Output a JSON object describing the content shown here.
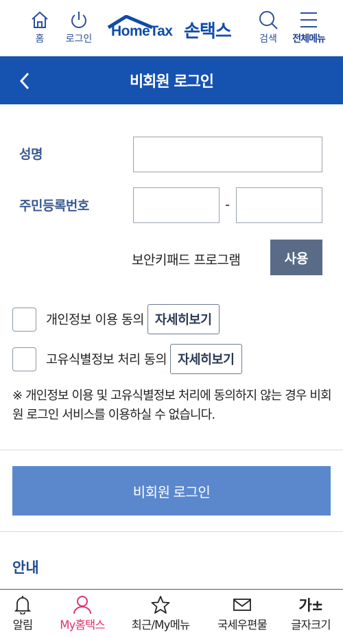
{
  "topbar": {
    "home_label": "홈",
    "login_label": "로그인",
    "logo_text": "HomeTax",
    "logo_kr": "손택스",
    "search_label": "검색",
    "menu_label": "전체메뉴"
  },
  "header": {
    "title": "비회원 로그인"
  },
  "form": {
    "name_label": "성명",
    "name_value": "",
    "rrn_label": "주민등록번호",
    "rrn_front_value": "",
    "rrn_dash": "-",
    "rrn_back_value": "",
    "keypad_label": "보안키패드 프로그램",
    "keypad_button": "사용"
  },
  "consents": [
    {
      "label": "개인정보 이용 동의",
      "detail_button": "자세히보기",
      "checked": false
    },
    {
      "label": "고유식별정보 처리 동의",
      "detail_button": "자세히보기",
      "checked": false
    }
  ],
  "notice": "※ 개인정보 이용 및 고유식별정보 처리에 동의하지 않는 경우 비회원 로그인 서비스를 이용하실 수 없습니다.",
  "submit_label": "비회원 로그인",
  "guide_title": "안내",
  "bottom_nav": [
    {
      "label": "알림",
      "icon": "bell-icon",
      "active": false
    },
    {
      "label": "My홈택스",
      "icon": "person-icon",
      "active": true
    },
    {
      "label": "최근/My메뉴",
      "icon": "star-icon",
      "active": false
    },
    {
      "label": "국세우편물",
      "icon": "mail-icon",
      "active": false
    },
    {
      "label": "글자크기",
      "icon": "font-size-icon",
      "icon_text": "가±",
      "active": false
    }
  ],
  "colors": {
    "header_bg": "#1652b0",
    "submit_bg": "#5b88cd",
    "keypad_btn_bg": "#5a6b87",
    "active_nav": "#e0326b",
    "label_color": "#3a5a92"
  }
}
